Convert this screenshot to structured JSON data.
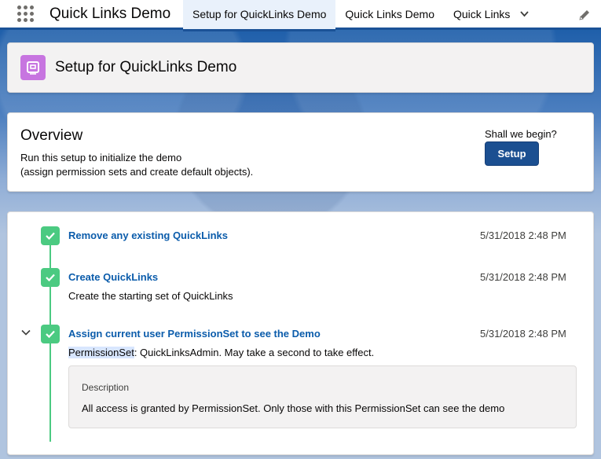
{
  "nav": {
    "app_name": "Quick Links Demo",
    "tabs": [
      {
        "label": "Setup for QuickLinks Demo",
        "active": true
      },
      {
        "label": "Quick Links Demo",
        "active": false
      },
      {
        "label": "Quick Links",
        "active": false,
        "has_menu": true
      }
    ],
    "icons": [
      "app-launcher-icon",
      "chevron-down-icon",
      "pencil-icon"
    ]
  },
  "header": {
    "title": "Setup for QuickLinks Demo",
    "icon": "object-icon",
    "icon_color": "#c775e0"
  },
  "overview": {
    "title": "Overview",
    "line1": "Run this setup to initialize the demo",
    "line2": "(assign permission sets and create default objects).",
    "prompt": "Shall we begin?",
    "button_label": "Setup",
    "button_color": "#1b4f91"
  },
  "timeline": {
    "line_color": "#4bca81",
    "items": [
      {
        "title": "Remove any existing QuickLinks",
        "date": "5/31/2018 2:48 PM",
        "status_icon": "check-icon"
      },
      {
        "title": "Create QuickLinks",
        "date": "5/31/2018 2:48 PM",
        "description": "Create the starting set of QuickLinks",
        "status_icon": "check-icon"
      },
      {
        "title": "Assign current user PermissionSet to see the Demo",
        "date": "5/31/2018 2:48 PM",
        "description_highlight": "PermissionSet",
        "description_rest": ": QuickLinksAdmin. May take a second to take effect.",
        "status_icon": "check-icon",
        "expanded": true,
        "detail_label": "Description",
        "detail_text": "All access is granted by PermissionSet. Only those with this PermissionSet can see the demo"
      }
    ]
  }
}
